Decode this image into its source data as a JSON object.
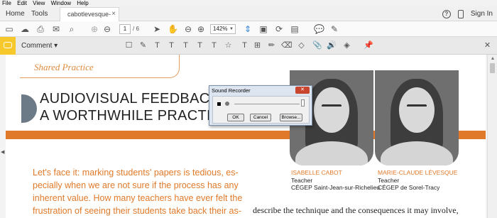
{
  "menubar": {
    "items": [
      "File",
      "Edit",
      "View",
      "Window",
      "Help"
    ]
  },
  "tabs": {
    "home": "Home",
    "tools": "Tools",
    "document": "cabotlevesque-vol...",
    "close": "×",
    "sign_in": "Sign In",
    "help": "?"
  },
  "toolbar": {
    "page_current": "1",
    "page_total": "/ 6",
    "zoom": "142%"
  },
  "comment_bar": {
    "label": "Comment"
  },
  "document": {
    "shared_practice": "Shared Practice",
    "title_line1": "AUDIOVISUAL FEEDBACK:",
    "title_line2": "A WORTHWHILE PRACTICE?",
    "person1": {
      "name": "ISABELLE CABOT",
      "role": "Teacher",
      "org": "CÉGEP Saint-Jean-sur-Richelieu"
    },
    "person2": {
      "name": "MARIE-CLAUDE LÉVESQUE",
      "role": "Teacher",
      "org": "CÉGEP de Sorel-Tracy"
    },
    "body_lines": [
      "Let's face it: marking students' papers is tedious, es-",
      "pecially when we are not sure if the process has any",
      "inherent value. How many teachers have ever felt the",
      "frustration of seeing their students take back their as-"
    ],
    "body_right": "describe the technique and the consequences it may involve,"
  },
  "dialog": {
    "title": "Sound Recorder",
    "close": "✕",
    "ok": "OK",
    "cancel": "Cancel",
    "browse": "Browse..."
  },
  "colors": {
    "accent_orange": "#e07a2a",
    "comment_yellow": "#f7c82c",
    "highlight_blue": "#2d7fd3"
  }
}
